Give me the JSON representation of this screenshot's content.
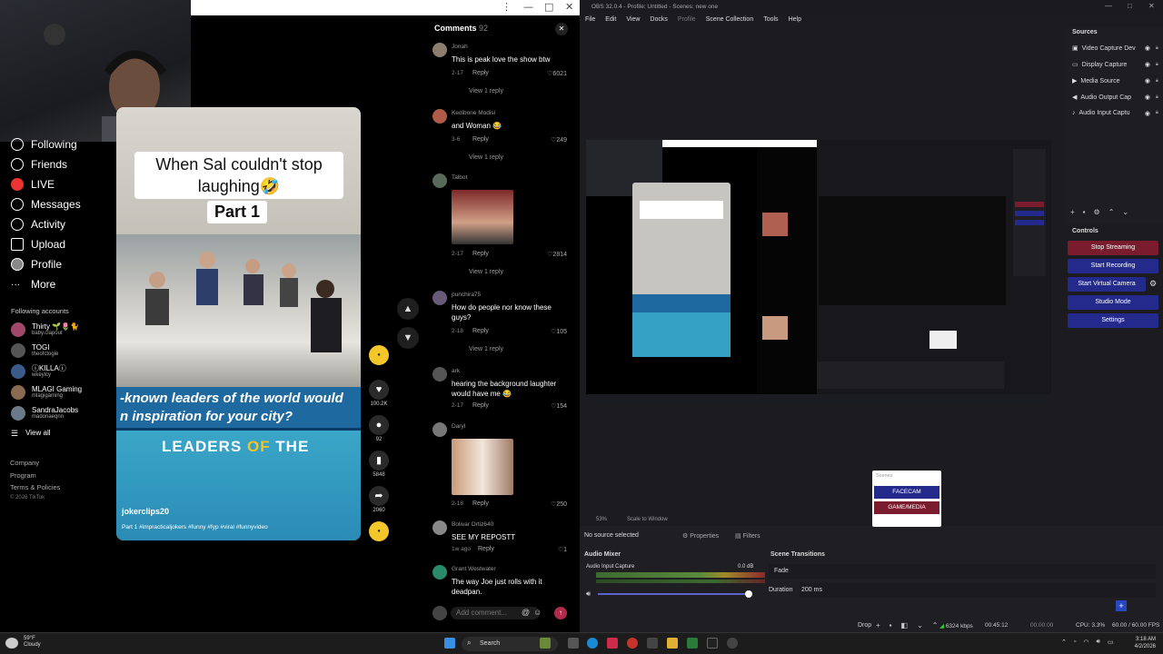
{
  "browser": {
    "title_controls": [
      "⋮",
      "—",
      "□",
      "✕"
    ]
  },
  "nav": [
    {
      "label": "Following",
      "icon": "following-icon"
    },
    {
      "label": "Friends",
      "icon": "friends-icon"
    },
    {
      "label": "LIVE",
      "icon": "live-icon"
    },
    {
      "label": "Messages",
      "icon": "messages-icon"
    },
    {
      "label": "Activity",
      "icon": "activity-icon"
    },
    {
      "label": "Upload",
      "icon": "upload-icon"
    },
    {
      "label": "Profile",
      "icon": "profile-icon"
    },
    {
      "label": "More",
      "icon": "more-icon"
    }
  ],
  "following_accounts": {
    "heading": "Following accounts",
    "accounts": [
      {
        "name": "Thirty 🌱🌷🐈",
        "handle": "baby.clapout"
      },
      {
        "name": "TOGI",
        "handle": "theofctogie"
      },
      {
        "name": "ⓘKILLAⓘ",
        "handle": "wkeylcy"
      },
      {
        "name": "MLAGI Gaming",
        "handle": "mlagigaming"
      },
      {
        "name": "SandraJacobs",
        "handle": "madonaeqnn"
      }
    ],
    "view_all": "View all"
  },
  "footer": {
    "links": [
      "Company",
      "Program",
      "Terms & Policies"
    ],
    "copyright": "© 2026 TikTok"
  },
  "video": {
    "title": "When Sal couldn't stop laughing🤣",
    "part": "Part 1",
    "banner_line1": "-known leaders of the world would",
    "banner_line2": "n inspiration for your city?",
    "lower_a": "LEADERS ",
    "lower_b": "OF",
    "lower_c": " THE",
    "author": "jokerclips20",
    "caption": "Part 1 #impracticaljokers #funny #fyp #viral #funnyvideo"
  },
  "actions": {
    "likes": "100.2K",
    "comments": "92",
    "saves": "5848",
    "shares": "2060"
  },
  "comments": {
    "title": "Comments",
    "count": "92",
    "items": [
      {
        "user": "Jonah",
        "text": "This is peak love the show btw",
        "date": "2-17",
        "reply": "Reply",
        "likes": "6021",
        "view": "View 1 reply"
      },
      {
        "user": "Kedibone Modisi",
        "text": "and Woman 😂",
        "date": "3-6",
        "reply": "Reply",
        "likes": "249",
        "view": "View 1 reply"
      },
      {
        "user": "Talbot",
        "text": "",
        "date": "2-17",
        "reply": "Reply",
        "likes": "2814",
        "view": "View 1 reply"
      },
      {
        "user": "punchira75",
        "text": "How do people nor know these guys?",
        "date": "2-18",
        "reply": "Reply",
        "likes": "105",
        "view": "View 1 reply"
      },
      {
        "user": "ark",
        "text": "hearing the background laughter would have me 😂",
        "date": "2-17",
        "reply": "Reply",
        "likes": "154",
        "view": ""
      },
      {
        "user": "Daryl",
        "text": "",
        "date": "2-18",
        "reply": "Reply",
        "likes": "250",
        "view": ""
      },
      {
        "user": "Bolivar Ortiz640",
        "text": "SEE MY REPOSTT",
        "date": "1w ago",
        "reply": "Reply",
        "likes": "1",
        "view": ""
      },
      {
        "user": "Grant Westwater",
        "text": "The way Joe just rolls with it deadpan.",
        "date": "",
        "reply": "",
        "likes": "",
        "view": ""
      }
    ],
    "input_placeholder": "Add comment..."
  },
  "obs": {
    "title": "OBS 32.0.4 - Profile: Untitled - Scenes: new one",
    "menu": [
      "File",
      "Edit",
      "View",
      "Docks",
      "Profile",
      "Scene Collection",
      "Tools",
      "Help"
    ],
    "sources_title": "Sources",
    "sources": [
      "Video Capture Dev",
      "Display Capture",
      "Media Source",
      "Audio Output Cap",
      "Audio Input Captu"
    ],
    "controls_title": "Controls",
    "controls": [
      "Stop Streaming",
      "Start Recording",
      "Start Virtual Camera",
      "Studio Mode",
      "Settings"
    ],
    "zoom": "53%",
    "scale": "Scale to Window",
    "no_source": "No source selected",
    "properties": "Properties",
    "filters": "Filters",
    "audio_mixer": "Audio Mixer",
    "mixer_track": "Audio Input Capture",
    "mixer_db": "0.0 dB",
    "transitions_title": "Scene Transitions",
    "transition": "Fade",
    "duration_label": "Duration",
    "duration": "200 ms",
    "scenes_header": "Scenes",
    "scenes": [
      "FACECAM",
      "GAME/MEDIA"
    ],
    "drop": "Drop",
    "stats": {
      "kbps": "6324 kbps",
      "stream_time": "00:45:12",
      "rec_time": "00:00:00",
      "cpu": "CPU: 3.3%",
      "fps": "60.00 / 60.00 FPS"
    }
  },
  "taskbar": {
    "weather_temp": "59°F",
    "weather_desc": "Cloudy",
    "search": "Search",
    "time": "3:18 AM",
    "date": "4/2/2026"
  }
}
